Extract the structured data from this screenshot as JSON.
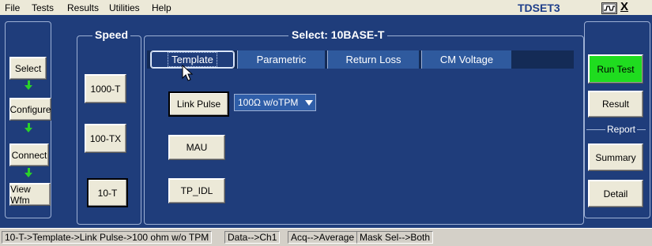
{
  "menu": {
    "items": [
      "File",
      "Tests",
      "Results",
      "Utilities",
      "Help"
    ],
    "app_title": "TDSET3",
    "close_label": "X"
  },
  "left_nav": {
    "buttons": [
      "Select",
      "Configure",
      "Connect",
      "View Wfm"
    ]
  },
  "speed": {
    "title": "Speed",
    "buttons": [
      "1000-T",
      "100-TX",
      "10-T"
    ]
  },
  "select_panel": {
    "title": "Select: 10BASE-T",
    "tabs": [
      "Template",
      "Parametric",
      "Return Loss",
      "CM Voltage"
    ],
    "active_tab": "Template",
    "test_buttons": [
      "Link Pulse",
      "MAU",
      "TP_IDL"
    ],
    "link_pulse_option": "100Ω w/oTPM"
  },
  "right_nav": {
    "run_test": "Run Test",
    "result": "Result",
    "report_title": "Report",
    "summary": "Summary",
    "detail": "Detail",
    "run_color": "#1fdc1f"
  },
  "status": {
    "path": "10-T->Template->Link Pulse->100 ohm w/o TPM",
    "data": "Data-->Ch1",
    "acq": "Acq-->Average",
    "mask": "Mask Sel-->Both"
  }
}
